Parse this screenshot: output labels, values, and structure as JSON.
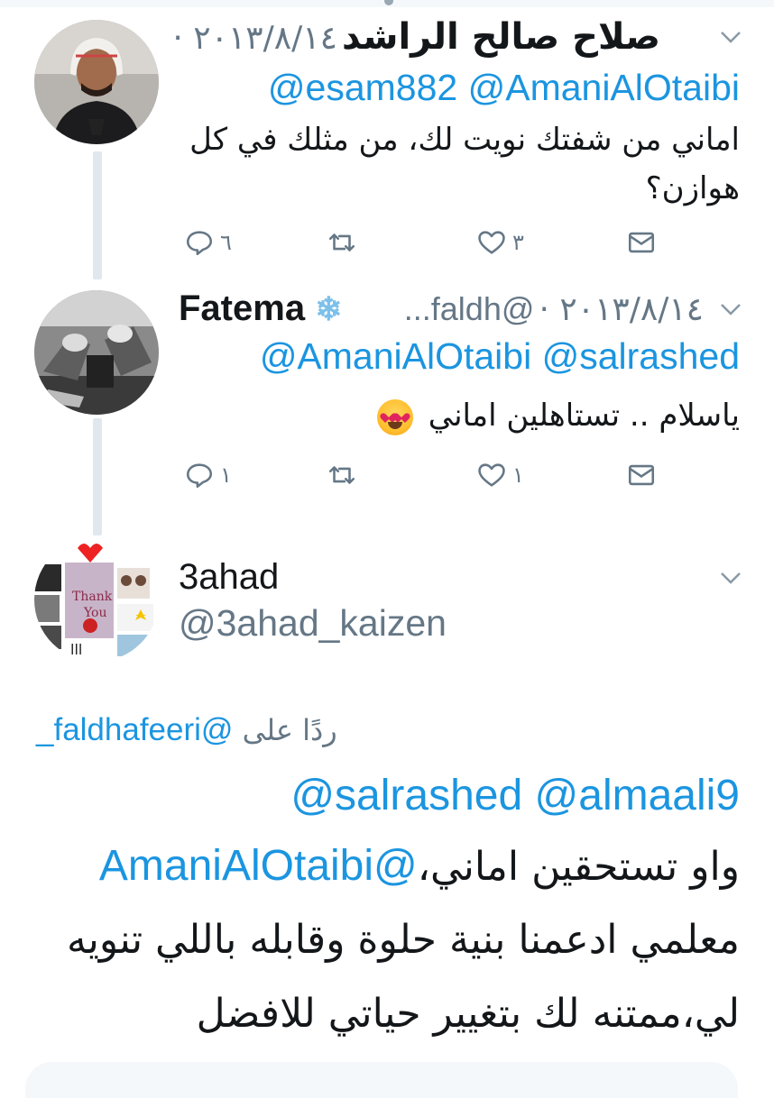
{
  "tweets": [
    {
      "name": "صلاح صالح الراشد",
      "date": "٢٠١٣/٨/١٤ ·",
      "mentions": "@esam882 @AmaniAlOtaibi",
      "body_lines": [
        "اماني من شفتك نويت لك، من مثلك في كل",
        "هوازن؟"
      ],
      "actions": {
        "reply_count": "٦",
        "retweet_count": "",
        "like_count": "٣"
      }
    },
    {
      "name": "Fatema",
      "handle": "@faldh...",
      "date": "٢٠١٣/٨/١٤ ·",
      "mentions": "@AmaniAlOtaibi @salrashed",
      "body": "ياسلام .. تستاهلين اماني",
      "actions": {
        "reply_count": "١",
        "retweet_count": "",
        "like_count": "١"
      }
    }
  ],
  "focused_tweet": {
    "name": "3ahad",
    "handle": "@3ahad_kaizen",
    "replying_to_label": "ردًا على",
    "replying_to_handle": "@faldhafeeri_",
    "mentions": "@salrashed @almaali9",
    "body_first_mention": "@AmaniAlOtaibi",
    "body_lines": [
      "واو تستحقين اماني،",
      "معلمي ادعمنا بنية حلوة وقابله باللي تنويه",
      "لي،ممتنه لك بتغيير حياتي للافضل"
    ]
  },
  "icons": {
    "reply": "reply-icon",
    "retweet": "retweet-icon",
    "like": "heart-icon",
    "message": "envelope-icon",
    "more": "chevron-down-icon",
    "badge": "snowflake-icon"
  },
  "colors": {
    "link": "#1b95e0",
    "secondary": "#657786",
    "thread_line": "#e1e8ed",
    "text": "#14171a"
  }
}
